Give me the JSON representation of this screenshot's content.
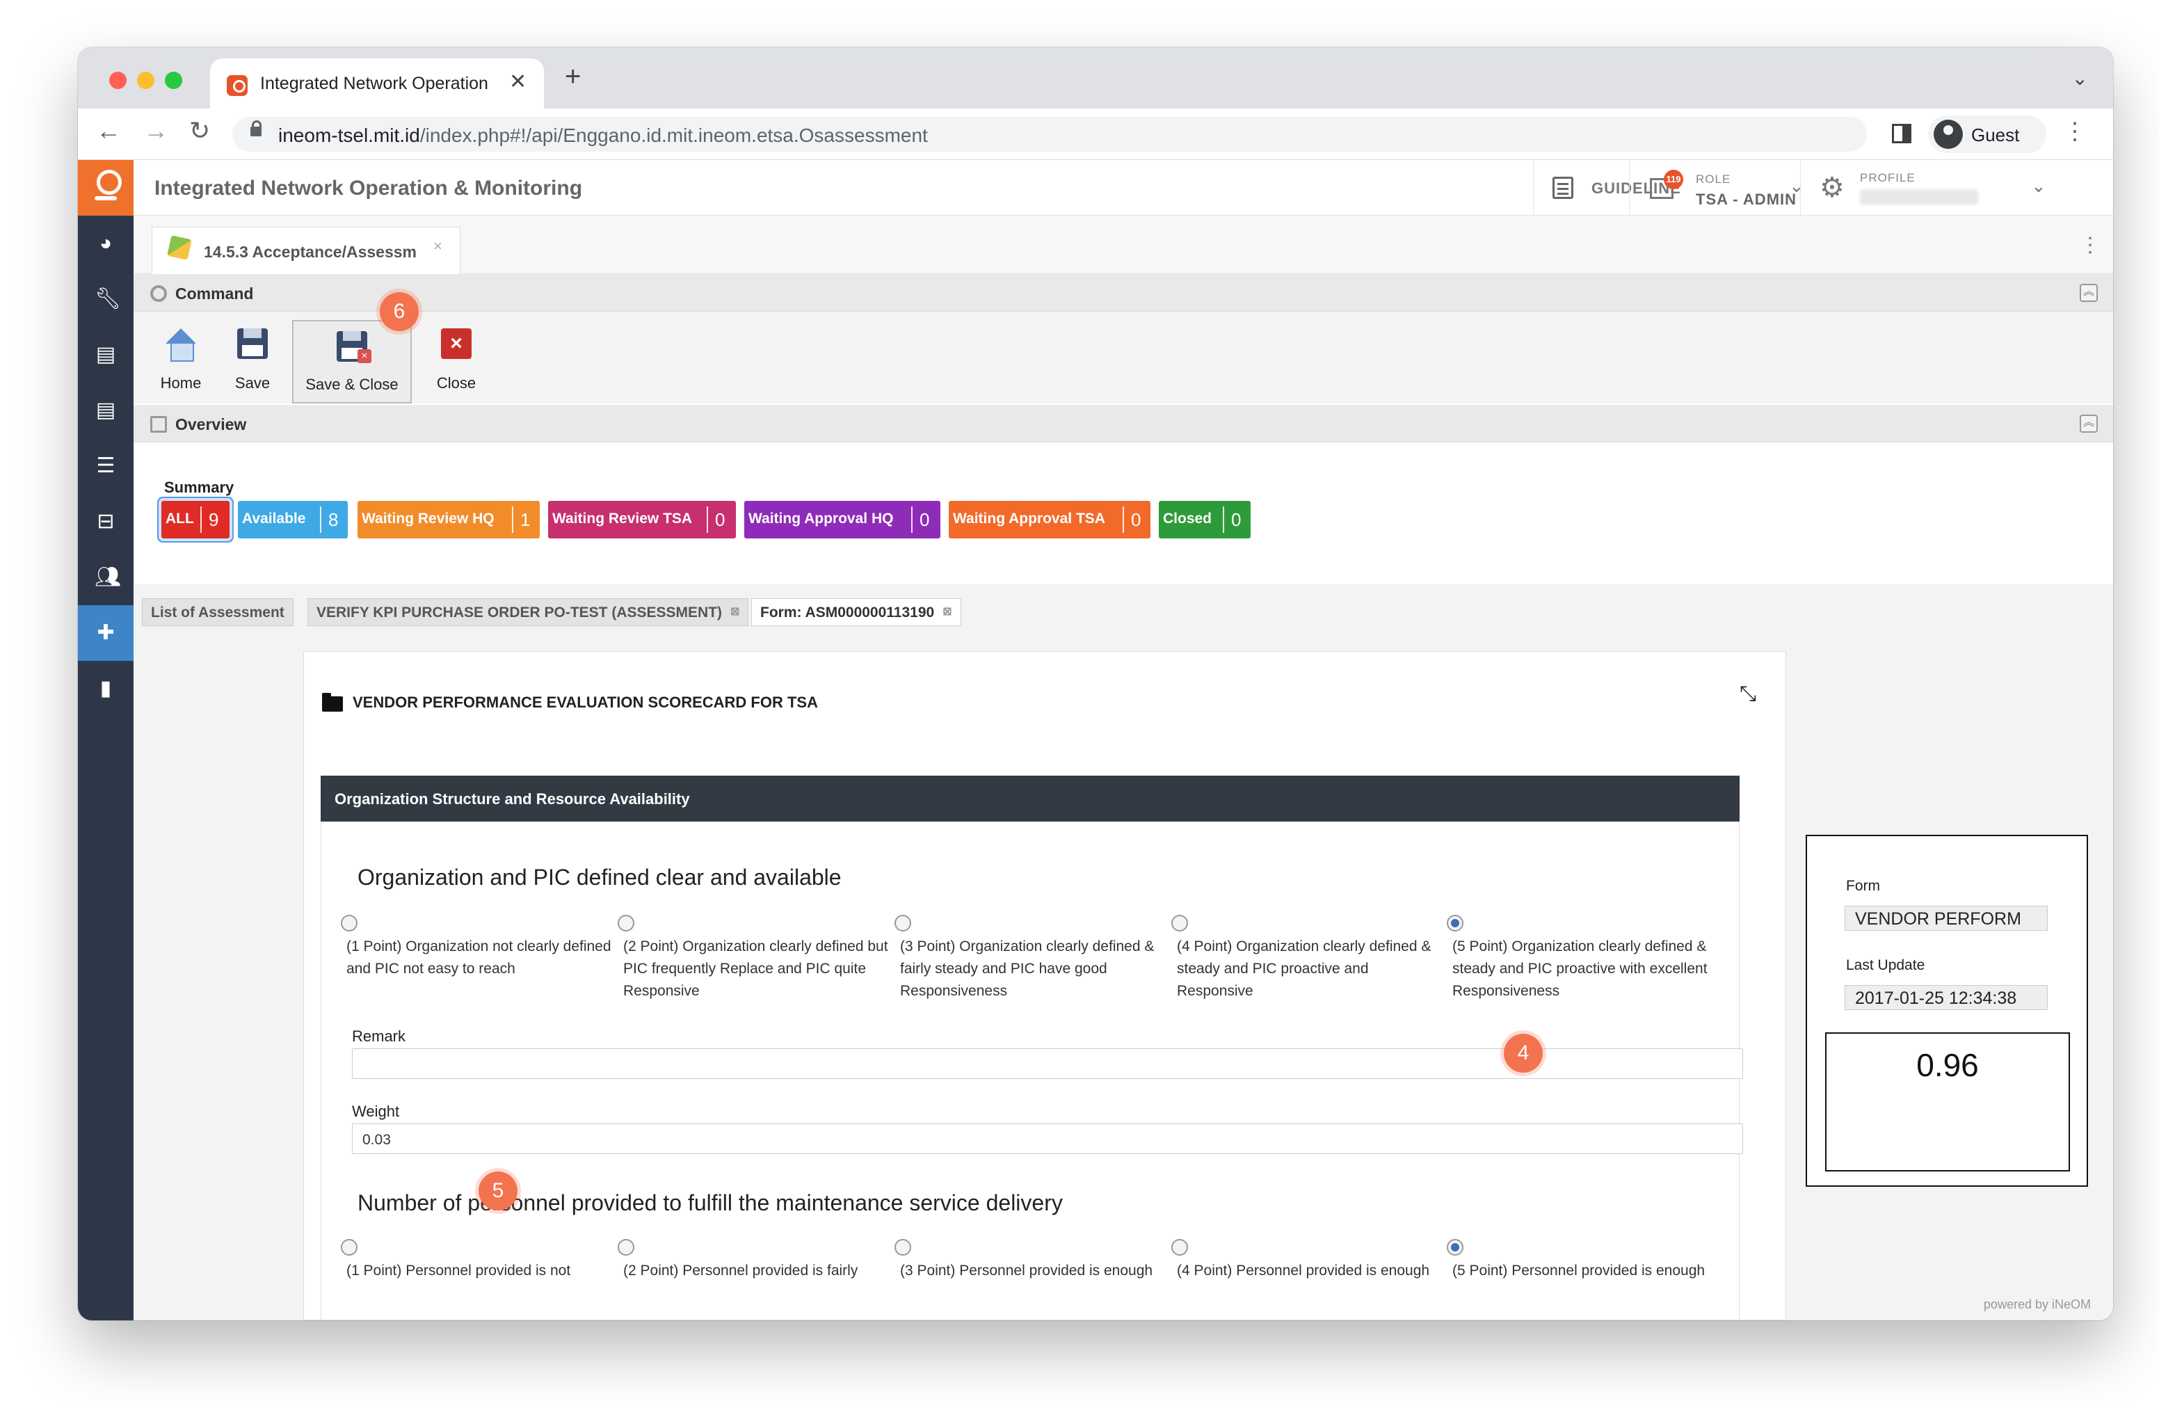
{
  "browser": {
    "tab_title": "Integrated Network Operation",
    "tab_close": "✕",
    "new_tab": "+",
    "url_host": "ineom-tsel.mit.id",
    "url_path": "/index.php#!/api/Enggano.id.mit.ineom.etsa.Osassessment",
    "guest_label": "Guest"
  },
  "app": {
    "title": "Integrated Network Operation & Monitoring",
    "guideline_label": "GUIDELINE",
    "role_caption": "ROLE",
    "role_value": "TSA - ADMIN",
    "role_badge": "119",
    "profile_caption": "PROFILE",
    "workspace_tab": "14.5.3 Acceptance/Assessm"
  },
  "sidebar": {
    "icons": [
      "dashboard-icon",
      "wrench-icon",
      "clipboard-icon",
      "clipboard-icon",
      "server-icon",
      "archive-icon",
      "users-icon",
      "puzzle-icon",
      "book-icon"
    ]
  },
  "command": {
    "section_label": "Command",
    "buttons": {
      "home": "Home",
      "save": "Save",
      "save_close": "Save & Close",
      "close": "Close"
    }
  },
  "overview": {
    "section_label": "Overview",
    "summary_label": "Summary",
    "pills": [
      {
        "name": "ALL",
        "count": "9",
        "color": "#e02b27"
      },
      {
        "name": "Available",
        "count": "8",
        "color": "#3fa9e6"
      },
      {
        "name": "Waiting Review HQ",
        "count": "1",
        "color": "#f28c2a"
      },
      {
        "name": "Waiting Review TSA",
        "count": "0",
        "color": "#c72f6f"
      },
      {
        "name": "Waiting Approval HQ",
        "count": "0",
        "color": "#8e2bb8"
      },
      {
        "name": "Waiting Approval TSA",
        "count": "0",
        "color": "#f26a2a"
      },
      {
        "name": "Closed",
        "count": "0",
        "color": "#2e9b3a"
      }
    ]
  },
  "subtabs": {
    "list": "List of Assessment",
    "verify": "VERIFY KPI PURCHASE ORDER PO-TEST (ASSESSMENT)",
    "form": "Form: ASM000000113190"
  },
  "form": {
    "title": "VENDOR PERFORMANCE EVALUATION SCORECARD FOR TSA",
    "section": "Organization Structure and Resource Availability",
    "q1": {
      "title": "Organization and PIC defined clear and available",
      "options": [
        "(1 Point) Organization not clearly defined and PIC not easy to reach",
        "(2 Point) Organization clearly defined but PIC frequently Replace and PIC quite Responsive",
        "(3 Point) Organization clearly defined & fairly steady and PIC have good Responsiveness",
        "(4 Point) Organization clearly defined & steady and PIC proactive and Responsive",
        "(5 Point) Organization clearly defined & steady and PIC proactive with excellent Responsiveness"
      ],
      "selected_index": 4,
      "remark_label": "Remark",
      "remark_value": "",
      "weight_label": "Weight",
      "weight_value": "0.03"
    },
    "q2": {
      "title": "Number of personnel provided to fulfill the maintenance service delivery",
      "options": [
        "(1 Point) Personnel provided is not",
        "(2 Point) Personnel provided is fairly",
        "(3 Point) Personnel provided is enough",
        "(4 Point) Personnel provided is enough",
        "(5 Point) Personnel provided is enough"
      ],
      "selected_index": 4
    }
  },
  "side_panel": {
    "form_label": "Form",
    "form_value": "VENDOR PERFORM",
    "update_label": "Last Update",
    "update_value": "2017-01-25 12:34:38",
    "score": "0.96"
  },
  "step_badges": {
    "save_close": "6",
    "option5": "4",
    "remark": "5"
  },
  "footer": "powered by iNeOM"
}
